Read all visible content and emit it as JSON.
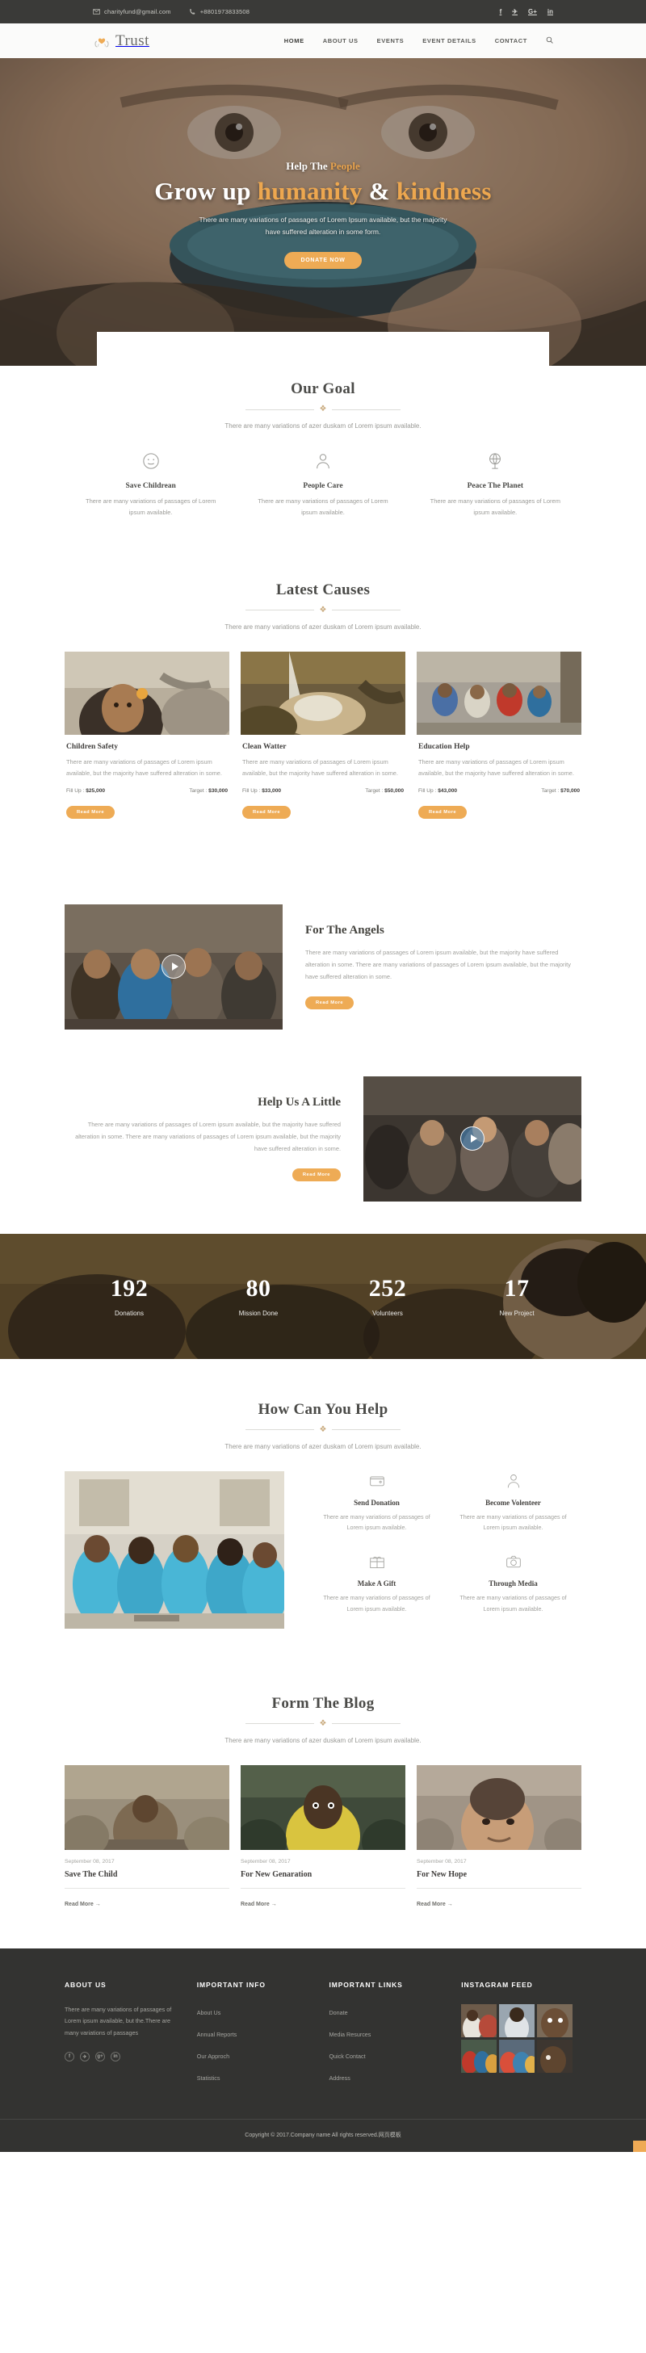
{
  "topbar": {
    "email": "charityfund@gmail.com",
    "phone": "+8801973833508",
    "email_icon": "envelope-icon",
    "phone_icon": "phone-icon",
    "social": [
      {
        "name": "facebook",
        "glyph": "f"
      },
      {
        "name": "twitter",
        "glyph": "✈"
      },
      {
        "name": "google-plus",
        "glyph": "G+"
      },
      {
        "name": "linkedin",
        "glyph": "in"
      }
    ]
  },
  "header": {
    "brand": "Trust",
    "brand_icon": "heart-hands-logo",
    "nav": [
      {
        "label": "HOME",
        "active": true
      },
      {
        "label": "ABOUT US",
        "active": false
      },
      {
        "label": "EVENTS",
        "active": false
      },
      {
        "label": "EVENT DETAILS",
        "active": false
      },
      {
        "label": "CONTACT",
        "active": false
      }
    ],
    "search_icon": "search-icon"
  },
  "hero": {
    "eyebrow_plain": "Help The",
    "eyebrow_accent": "People",
    "title_part1": "Grow up ",
    "title_accent1": "humanity",
    "title_part2": " & ",
    "title_accent2": "kindness",
    "desc": "There are many variations of passages of Lorem Ipsum available, but the majority have suffered alteration in some form.",
    "cta": "DONATE NOW"
  },
  "goal": {
    "title": "Our Goal",
    "subtitle": "There are many variations of azer duskam of Lorem ipsum available.",
    "items": [
      {
        "icon": "smiley-face-icon",
        "title": "Save Childrean",
        "text": "There are many variations of passages of Lorem ipsum available."
      },
      {
        "icon": "person-icon",
        "title": "People Care",
        "text": "There are many variations of passages of Lorem ipsum available."
      },
      {
        "icon": "globe-icon",
        "title": "Peace The Planet",
        "text": "There are many variations of passages of Lorem ipsum available."
      }
    ]
  },
  "causes": {
    "title": "Latest Causes",
    "subtitle": "There are many variations of azer duskam of Lorem ipsum available.",
    "items": [
      {
        "title": "Children Safety",
        "text": "There are many variations of passages of Lorem ipsum available, but the majority have suffered alteration in some.",
        "fill_label": "Fill Up :",
        "fill_value": "$25,000",
        "target_label": "Target :",
        "target_value": "$30,000",
        "button": "Read More"
      },
      {
        "title": "Clean Watter",
        "text": "There are many variations of passages of Lorem ipsum available, but the majority have suffered alteration in some.",
        "fill_label": "Fill Up :",
        "fill_value": "$33,000",
        "target_label": "Target :",
        "target_value": "$50,000",
        "button": "Read More"
      },
      {
        "title": "Education Help",
        "text": "There are many variations of passages of Lorem ipsum available, but the majority have suffered alteration in some.",
        "fill_label": "Fill Up :",
        "fill_value": "$43,000",
        "target_label": "Target :",
        "target_value": "$70,000",
        "button": "Read More"
      }
    ]
  },
  "angels": {
    "title": "For The Angels",
    "text": "There are many variations of passages of Lorem ipsum available, but the majority have suffered alteration in some. There are many variations of passages of Lorem ipsum available, but the majority have suffered alteration in some.",
    "button": "Read More",
    "play_icon": "play-icon"
  },
  "helplittle": {
    "title": "Help Us A Little",
    "text": "There are many variations of passages of Lorem ipsum available, but the majority have suffered alteration in some. There are many variations of passages of Lorem ipsum available, but the majority have suffered alteration in some.",
    "button": "Read More",
    "play_icon": "play-icon"
  },
  "counters": [
    {
      "number": "192",
      "label": "Donations"
    },
    {
      "number": "80",
      "label": "Mission Done"
    },
    {
      "number": "252",
      "label": "Volunteers"
    },
    {
      "number": "17",
      "label": "New Project"
    }
  ],
  "help": {
    "title": "How Can You Help",
    "subtitle": "There are many variations of azer duskam of Lorem ipsum available.",
    "items": [
      {
        "icon": "wallet-icon",
        "title": "Send Donation",
        "text": "There are many variations of passages of Lorem ipsum available."
      },
      {
        "icon": "person-icon",
        "title": "Become Volenteer",
        "text": "There are many variations of passages of Lorem ipsum available."
      },
      {
        "icon": "gift-box-icon",
        "title": "Make A Gift",
        "text": "There are many variations of passages of Lorem ipsum available."
      },
      {
        "icon": "camera-icon",
        "title": "Through Media",
        "text": "There are many variations of passages of Lorem ipsum available."
      }
    ]
  },
  "blog": {
    "title": "Form The Blog",
    "subtitle": "There are many variations of azer duskam of Lorem ipsum available.",
    "items": [
      {
        "date": "September 08, 2017",
        "title": "Save The Child",
        "more": "Read More  →"
      },
      {
        "date": "September 08, 2017",
        "title": "For New Genaration",
        "more": "Read More  →"
      },
      {
        "date": "September 08, 2017",
        "title": "For New Hope",
        "more": "Read More  →"
      }
    ]
  },
  "footer": {
    "about": {
      "heading": "ABOUT US",
      "text": "There are many variations of passages of Lorem ipsum available, but the.There are many variations of passages",
      "social": [
        {
          "name": "facebook",
          "glyph": "f"
        },
        {
          "name": "twitter",
          "glyph": "✈"
        },
        {
          "name": "google-plus",
          "glyph": "g+"
        },
        {
          "name": "linkedin",
          "glyph": "in"
        }
      ]
    },
    "info": {
      "heading": "IMPORTANT INFO",
      "links": [
        "About Us",
        "Annual Reports",
        "Our Approch",
        "Statistics"
      ]
    },
    "links": {
      "heading": "IMPORTANT LINKS",
      "links": [
        "Donate",
        "Media Resurces",
        "Quick Contact",
        "Address"
      ]
    },
    "instagram": {
      "heading": "INSTAGRAM FEED"
    },
    "copyright": "Copyright © 2017.Company name All rights reserved.网页模板"
  },
  "colors": {
    "accent": "#eeab55",
    "dark": "#333331",
    "topbar": "#3a3a38"
  }
}
